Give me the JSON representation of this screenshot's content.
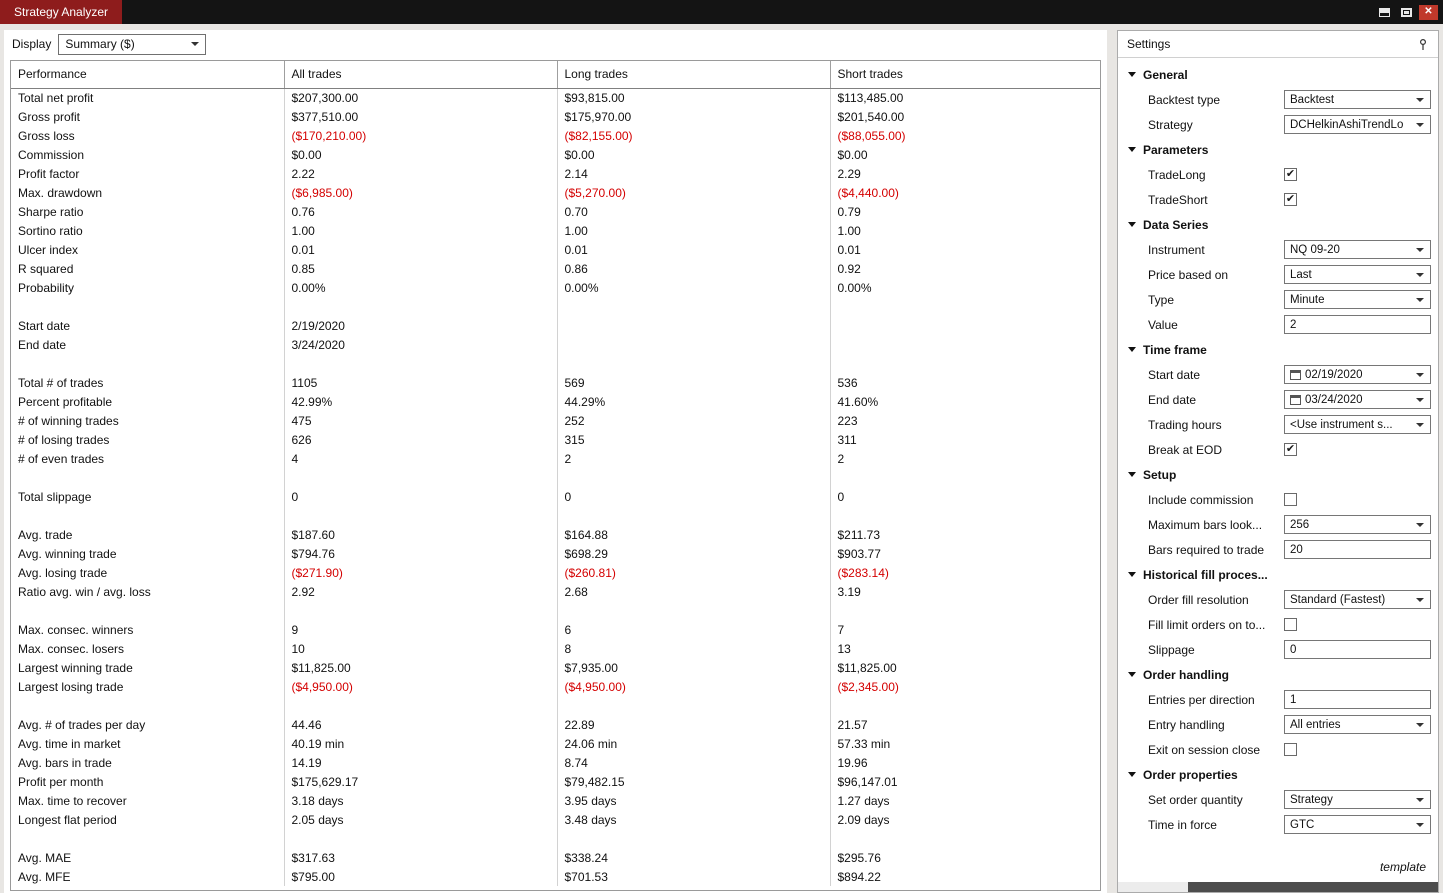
{
  "window": {
    "title": "Strategy Analyzer"
  },
  "toolbar": {
    "display_label": "Display",
    "display_value": "Summary ($)"
  },
  "table": {
    "headers": [
      "Performance",
      "All trades",
      "Long trades",
      "Short trades"
    ],
    "rows": [
      {
        "label": "Total net profit",
        "all": "$207,300.00",
        "long": "$93,815.00",
        "short": "$113,485.00"
      },
      {
        "label": "Gross profit",
        "all": "$377,510.00",
        "long": "$175,970.00",
        "short": "$201,540.00"
      },
      {
        "label": "Gross loss",
        "all": "($170,210.00)",
        "long": "($82,155.00)",
        "short": "($88,055.00)"
      },
      {
        "label": "Commission",
        "all": "$0.00",
        "long": "$0.00",
        "short": "$0.00"
      },
      {
        "label": "Profit factor",
        "all": "2.22",
        "long": "2.14",
        "short": "2.29"
      },
      {
        "label": "Max. drawdown",
        "all": "($6,985.00)",
        "long": "($5,270.00)",
        "short": "($4,440.00)"
      },
      {
        "label": "Sharpe ratio",
        "all": "0.76",
        "long": "0.70",
        "short": "0.79"
      },
      {
        "label": "Sortino ratio",
        "all": "1.00",
        "long": "1.00",
        "short": "1.00"
      },
      {
        "label": "Ulcer index",
        "all": "0.01",
        "long": "0.01",
        "short": "0.01"
      },
      {
        "label": "R squared",
        "all": "0.85",
        "long": "0.86",
        "short": "0.92"
      },
      {
        "label": "Probability",
        "all": "0.00%",
        "long": "0.00%",
        "short": "0.00%"
      },
      {
        "spacer": true
      },
      {
        "label": "Start date",
        "all": "2/19/2020",
        "long": "",
        "short": ""
      },
      {
        "label": "End date",
        "all": "3/24/2020",
        "long": "",
        "short": ""
      },
      {
        "spacer": true
      },
      {
        "label": "Total # of trades",
        "all": "1105",
        "long": "569",
        "short": "536"
      },
      {
        "label": "Percent profitable",
        "all": "42.99%",
        "long": "44.29%",
        "short": "41.60%"
      },
      {
        "label": "# of winning trades",
        "all": "475",
        "long": "252",
        "short": "223"
      },
      {
        "label": "# of losing trades",
        "all": "626",
        "long": "315",
        "short": "311"
      },
      {
        "label": "# of even trades",
        "all": "4",
        "long": "2",
        "short": "2"
      },
      {
        "spacer": true
      },
      {
        "label": "Total slippage",
        "all": "0",
        "long": "0",
        "short": "0"
      },
      {
        "spacer": true
      },
      {
        "label": "Avg. trade",
        "all": "$187.60",
        "long": "$164.88",
        "short": "$211.73"
      },
      {
        "label": "Avg. winning trade",
        "all": "$794.76",
        "long": "$698.29",
        "short": "$903.77"
      },
      {
        "label": "Avg. losing trade",
        "all": "($271.90)",
        "long": "($260.81)",
        "short": "($283.14)"
      },
      {
        "label": "Ratio avg. win / avg. loss",
        "all": "2.92",
        "long": "2.68",
        "short": "3.19"
      },
      {
        "spacer": true
      },
      {
        "label": "Max. consec. winners",
        "all": "9",
        "long": "6",
        "short": "7"
      },
      {
        "label": "Max. consec. losers",
        "all": "10",
        "long": "8",
        "short": "13"
      },
      {
        "label": "Largest winning trade",
        "all": "$11,825.00",
        "long": "$7,935.00",
        "short": "$11,825.00"
      },
      {
        "label": "Largest losing trade",
        "all": "($4,950.00)",
        "long": "($4,950.00)",
        "short": "($2,345.00)"
      },
      {
        "spacer": true
      },
      {
        "label": "Avg. # of trades per day",
        "all": "44.46",
        "long": "22.89",
        "short": "21.57"
      },
      {
        "label": "Avg. time in market",
        "all": "40.19 min",
        "long": "24.06 min",
        "short": "57.33 min"
      },
      {
        "label": "Avg. bars in trade",
        "all": "14.19",
        "long": "8.74",
        "short": "19.96"
      },
      {
        "label": "Profit per month",
        "all": "$175,629.17",
        "long": "$79,482.15",
        "short": "$96,147.01"
      },
      {
        "label": "Max. time to recover",
        "all": "3.18 days",
        "long": "3.95 days",
        "short": "1.27 days"
      },
      {
        "label": "Longest flat period",
        "all": "2.05 days",
        "long": "3.48 days",
        "short": "2.09 days"
      },
      {
        "spacer": true
      },
      {
        "label": "Avg. MAE",
        "all": "$317.63",
        "long": "$338.24",
        "short": "$295.76"
      },
      {
        "label": "Avg. MFE",
        "all": "$795.00",
        "long": "$701.53",
        "short": "$894.22"
      }
    ]
  },
  "settings": {
    "title": "Settings",
    "footer": "template",
    "negative_color": "#d40000",
    "titlebar_color": "#8e1c1c",
    "sections": [
      {
        "label": "General",
        "rows": [
          {
            "label": "Backtest type",
            "control": "select",
            "value": "Backtest"
          },
          {
            "label": "Strategy",
            "control": "select",
            "value": "DCHelkinAshiTrendLo"
          }
        ]
      },
      {
        "label": "Parameters",
        "rows": [
          {
            "label": "TradeLong",
            "control": "check",
            "checked": true
          },
          {
            "label": "TradeShort",
            "control": "check",
            "checked": true
          }
        ]
      },
      {
        "label": "Data Series",
        "rows": [
          {
            "label": "Instrument",
            "control": "select",
            "value": "NQ 09-20"
          },
          {
            "label": "Price based on",
            "control": "select",
            "value": "Last"
          },
          {
            "label": "Type",
            "control": "select",
            "value": "Minute"
          },
          {
            "label": "Value",
            "control": "text",
            "value": "2"
          }
        ]
      },
      {
        "label": "Time frame",
        "rows": [
          {
            "label": "Start date",
            "control": "date",
            "value": "02/19/2020"
          },
          {
            "label": "End date",
            "control": "date",
            "value": "03/24/2020"
          },
          {
            "label": "Trading hours",
            "control": "select",
            "value": "<Use instrument s..."
          },
          {
            "label": "Break at EOD",
            "control": "check",
            "checked": true
          }
        ]
      },
      {
        "label": "Setup",
        "rows": [
          {
            "label": "Include commission",
            "control": "check",
            "checked": false
          },
          {
            "label": "Maximum bars look...",
            "control": "select",
            "value": "256"
          },
          {
            "label": "Bars required to trade",
            "control": "text",
            "value": "20"
          }
        ]
      },
      {
        "label": "Historical fill proces...",
        "rows": [
          {
            "label": "Order fill resolution",
            "control": "select",
            "value": "Standard (Fastest)"
          },
          {
            "label": "Fill limit orders on to...",
            "control": "check",
            "checked": false
          },
          {
            "label": "Slippage",
            "control": "text",
            "value": "0"
          }
        ]
      },
      {
        "label": "Order handling",
        "rows": [
          {
            "label": "Entries per direction",
            "control": "text",
            "value": "1"
          },
          {
            "label": "Entry handling",
            "control": "select",
            "value": "All entries"
          },
          {
            "label": "Exit on session close",
            "control": "check",
            "checked": false
          }
        ]
      },
      {
        "label": "Order properties",
        "rows": [
          {
            "label": "Set order quantity",
            "control": "select",
            "value": "Strategy"
          },
          {
            "label": "Time in force",
            "control": "select",
            "value": "GTC"
          }
        ]
      }
    ]
  }
}
